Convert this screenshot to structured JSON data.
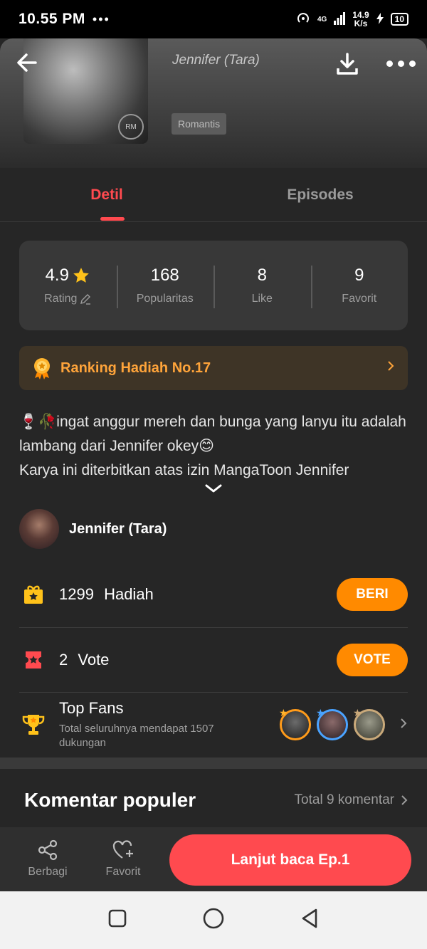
{
  "status_bar": {
    "time": "10.55 PM",
    "dots": "•••",
    "network": "4G",
    "speed_value": "14.9",
    "speed_unit": "K/s",
    "battery": "10"
  },
  "header": {
    "author": "Jennifer (Tara)",
    "genre": "Romantis",
    "cover_badge": "RM"
  },
  "tabs": [
    {
      "label": "Detil",
      "active": true
    },
    {
      "label": "Episodes",
      "active": false
    }
  ],
  "stats": [
    {
      "value": "4.9",
      "label": "Rating"
    },
    {
      "value": "168",
      "label": "Popularitas"
    },
    {
      "value": "8",
      "label": "Like"
    },
    {
      "value": "9",
      "label": "Favorit"
    }
  ],
  "ranking": {
    "label": "Ranking Hadiah No.17"
  },
  "description": {
    "line1": "🍷🥀ingat anggur mereh dan bunga yang lanyu itu adalah lambang dari Jennifer okey😊",
    "line2": "Karya ini diterbitkan atas izin MangaToon Jennifer"
  },
  "author_row": {
    "name": "Jennifer (Tara)"
  },
  "gift": {
    "count": "1299",
    "label": "Hadiah",
    "button": "BERI"
  },
  "vote": {
    "count": "2",
    "label": "Vote",
    "button": "VOTE"
  },
  "top_fans": {
    "title": "Top Fans",
    "subtitle": "Total seluruhnya mendapat 1507 dukungan"
  },
  "comments": {
    "title": "Komentar populer",
    "total": "Total 9 komentar"
  },
  "bottom_bar": {
    "share": "Berbagi",
    "favorite": "Favorit",
    "read": "Lanjut baca Ep.1"
  },
  "colors": {
    "accent": "#ff4a4f",
    "orange": "#ff8a00",
    "gold": "#ffa43a",
    "background": "#262626"
  }
}
